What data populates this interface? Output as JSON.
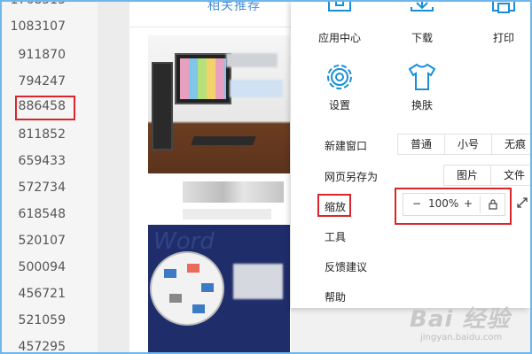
{
  "numbers": {
    "items": [
      "1083107",
      "911870",
      "794247",
      "886458",
      "811852",
      "659433",
      "572734",
      "618548",
      "520107",
      "500094",
      "456721",
      "521059",
      "457295"
    ],
    "highlighted": "886458"
  },
  "article": {
    "related_title": "相关推荐"
  },
  "menu": {
    "tools": [
      {
        "label": "应用中心",
        "icon": "app-center-icon"
      },
      {
        "label": "下载",
        "icon": "download-icon"
      },
      {
        "label": "打印",
        "icon": "print-icon"
      },
      {
        "label": "设置",
        "icon": "gear-icon"
      },
      {
        "label": "换肤",
        "icon": "tshirt-icon"
      }
    ],
    "new_window": {
      "label": "新建窗口",
      "options": [
        "普通",
        "小号",
        "无痕"
      ]
    },
    "save_as": {
      "label": "网页另存为",
      "options": [
        "图片",
        "文件"
      ]
    },
    "zoom": {
      "label": "缩放",
      "minus": "−",
      "value": "100%",
      "plus": "+"
    },
    "tools_label": "工具",
    "feedback_label": "反馈建议",
    "help_label": "帮助"
  },
  "watermark": {
    "main": "Bai 经验",
    "sub": "jingyan.baidu.com"
  },
  "colors": {
    "accent": "#1a8fd6",
    "highlight": "#d9262c"
  }
}
